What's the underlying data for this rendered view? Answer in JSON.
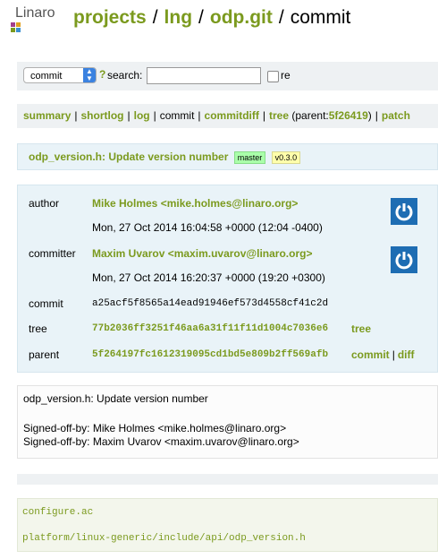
{
  "header": {
    "logo_text": "Linaro",
    "crumbs": [
      "projects",
      "lng",
      "odp.git"
    ],
    "current": "commit"
  },
  "search": {
    "select_value": "commit",
    "help": "?",
    "label": "search:",
    "input_value": "",
    "re_label": "re"
  },
  "nav": {
    "items": [
      "summary",
      "shortlog",
      "log",
      "commit",
      "commitdiff",
      "tree"
    ],
    "parent_prefix": "(parent:",
    "parent_hash": "5f26419",
    "parent_suffix": ")",
    "patch": "patch"
  },
  "title": {
    "text": "odp_version.h: Update version number",
    "tag_head": "master",
    "tag_version": "v0.3.0"
  },
  "info": {
    "author_label": "author",
    "author": "Mike Holmes <mike.holmes@linaro.org>",
    "author_date": "Mon, 27 Oct 2014 16:04:58 +0000 (12:04 -0400)",
    "committer_label": "committer",
    "committer": "Maxim Uvarov <maxim.uvarov@linaro.org>",
    "committer_date": "Mon, 27 Oct 2014 16:20:37 +0000 (19:20 +0300)",
    "commit_label": "commit",
    "commit_hash": "a25acf5f8565a14ead91946ef573d4558cf41c2d",
    "tree_label": "tree",
    "tree_hash": "77b2036ff3251f46aa6a31f11f11d1004c7036e6",
    "tree_link": "tree",
    "parent_label": "parent",
    "parent_hash": "5f264197fc1612319095cd1bd5e809b2ff569afb",
    "parent_commit_link": "commit",
    "parent_diff_link": "diff"
  },
  "message": {
    "subject": "odp_version.h: Update version number",
    "signoff1": "Signed-off-by: Mike Holmes <mike.holmes@linaro.org>",
    "signoff2": "Signed-off-by: Maxim Uvarov <maxim.uvarov@linaro.org>"
  },
  "files": [
    "configure.ac",
    "platform/linux-generic/include/api/odp_version.h"
  ],
  "colors": {
    "link": "#7b9a1e",
    "avatar": "#1e6db3",
    "panel": "#e9f3f8"
  }
}
